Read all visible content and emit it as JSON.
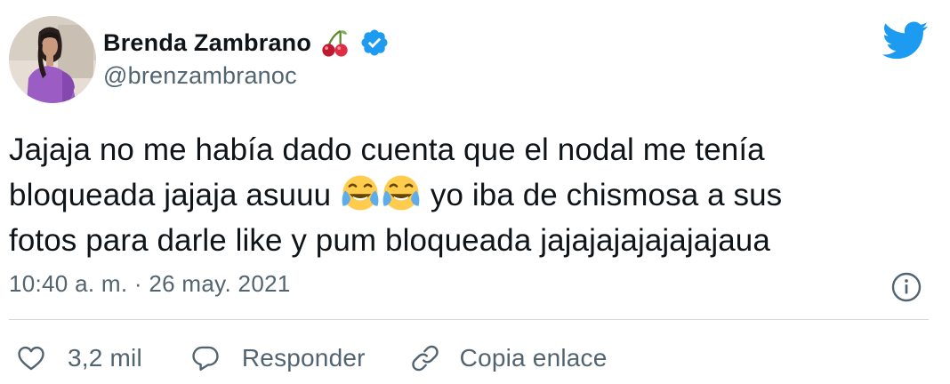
{
  "colors": {
    "brand": "#1d9bf0",
    "text": "#0f1419",
    "muted": "#536471",
    "divider": "#cfd9de"
  },
  "author": {
    "display_name": "Brenda Zambrano",
    "handle": "@brenzambranoc",
    "name_emoji": "cherries",
    "verified": true
  },
  "icons": {
    "brand": "twitter-bird-icon",
    "verified": "verified-badge-icon",
    "info": "info-icon",
    "like": "heart-icon",
    "reply": "speech-bubble-icon",
    "copy": "link-icon"
  },
  "tweet": {
    "line1": "Jajaja no me había dado cuenta que el nodal me tenía",
    "line2_before": "bloqueada jajaja asuuu ",
    "line2_emoji": "face-with-tears-of-joy",
    "line2_after": " yo iba de chismosa a sus",
    "line3": "fotos para darle like y pum bloqueada jajajajajajajajaua"
  },
  "timestamp": "10:40 a. m. · 26 may. 2021",
  "actions": {
    "like_count": "3,2 mil",
    "reply_label": "Responder",
    "copy_label": "Copia enlace"
  }
}
